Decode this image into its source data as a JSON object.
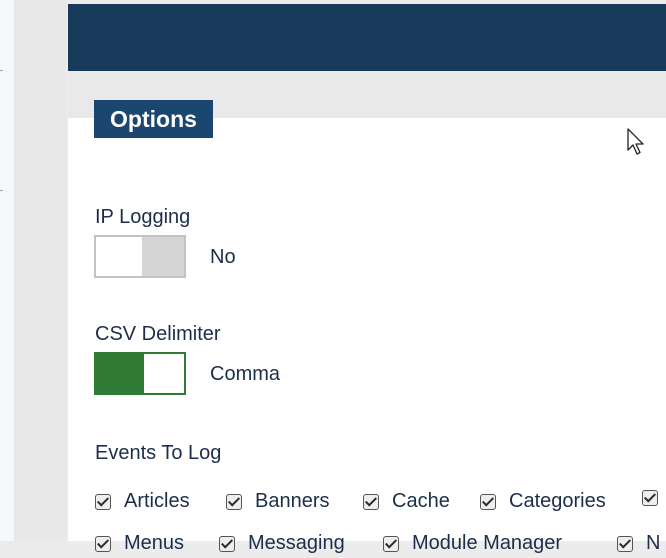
{
  "tab": {
    "label": "Options"
  },
  "ip_logging": {
    "label": "IP Logging",
    "value": "No",
    "enabled": false
  },
  "csv_delimiter": {
    "label": "CSV Delimiter",
    "value": "Comma",
    "enabled": true
  },
  "events": {
    "label": "Events To Log",
    "row1": [
      "Articles",
      "Banners",
      "Cache",
      "Categories"
    ],
    "row2": [
      "Menus",
      "Messaging",
      "Module Manager",
      "N"
    ]
  },
  "colors": {
    "header": "#173a5b",
    "tab": "#1b4670",
    "toggle_on": "#2f7a34",
    "toggle_off": "#d4d4d4",
    "text": "#1c2e4a"
  }
}
